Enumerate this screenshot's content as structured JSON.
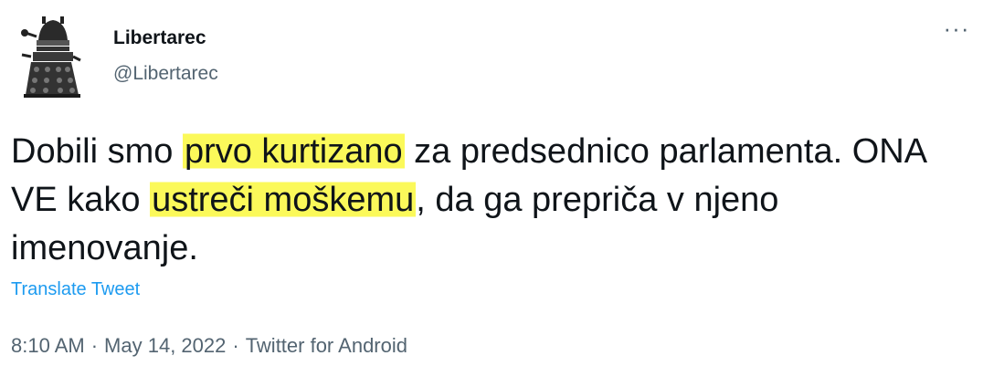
{
  "author": {
    "display_name": "Libertarec",
    "handle": "@Libertarec",
    "avatar_icon": "dalek-avatar-icon"
  },
  "more_button": {
    "label": "···"
  },
  "tweet": {
    "segments": [
      "Dobili smo ",
      "prvo kurtizano",
      " za predsednico parlamenta. ONA VE kako ",
      "ustreči moškemu",
      ", da ga prepriča v njeno imenovanje."
    ],
    "highlighted_segments": [
      1,
      3
    ],
    "highlight_color": "#fbf95a"
  },
  "translate": {
    "label": "Translate Tweet"
  },
  "meta": {
    "time": "8:10 AM",
    "separator": "·",
    "date": "May 14, 2022",
    "source": "Twitter for Android"
  },
  "colors": {
    "text_primary": "#0f1419",
    "text_secondary": "#536471",
    "link": "#1d9bf0"
  }
}
